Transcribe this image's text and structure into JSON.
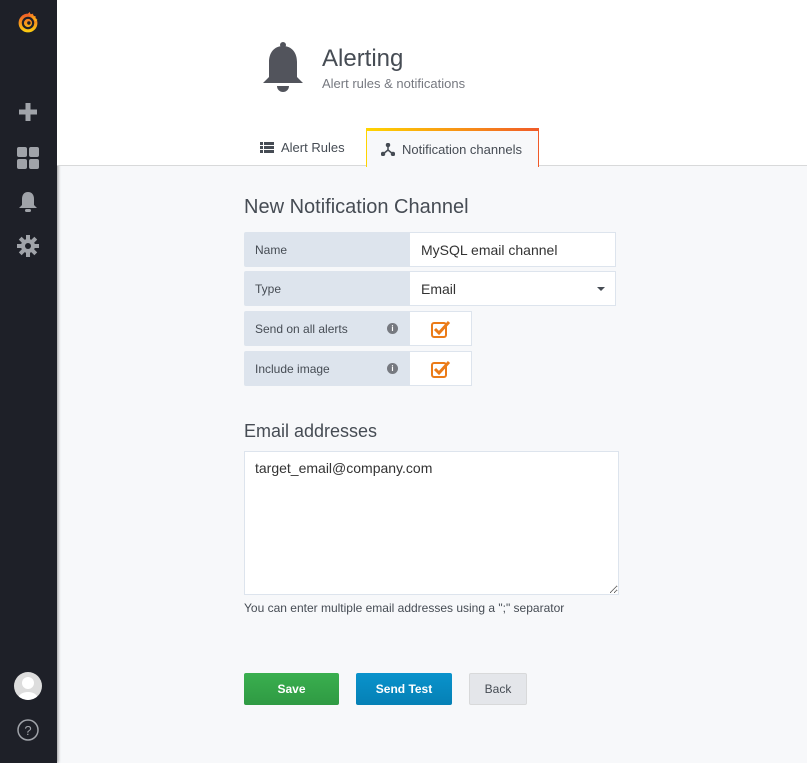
{
  "sidebar": {
    "items": [
      "grafana-logo",
      "add",
      "dashboards",
      "alerting",
      "configuration",
      "profile",
      "help"
    ]
  },
  "header": {
    "title": "Alerting",
    "subtitle": "Alert rules & notifications"
  },
  "tabs": [
    {
      "label": "Alert Rules"
    },
    {
      "label": "Notification channels"
    }
  ],
  "form": {
    "title": "New Notification Channel",
    "name_label": "Name",
    "name_value": "MySQL email channel",
    "type_label": "Type",
    "type_value": "Email",
    "send_all_label": "Send on all alerts",
    "send_all_checked": true,
    "include_image_label": "Include image",
    "include_image_checked": true,
    "info_glyph": "i",
    "email_title": "Email addresses",
    "email_value": "target_email@company.com",
    "email_hint": "You can enter multiple email addresses using a \";\" separator"
  },
  "buttons": {
    "save": "Save",
    "send_test": "Send Test",
    "back": "Back"
  },
  "colors": {
    "save": "#36a54b",
    "send_test": "#0589c0",
    "check": "#eb7b18"
  }
}
